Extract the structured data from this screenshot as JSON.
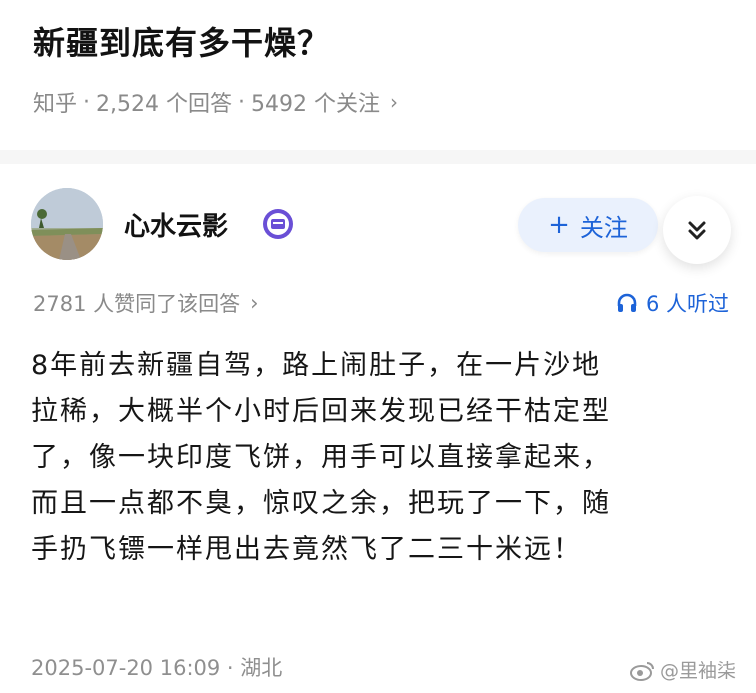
{
  "question": {
    "title": "新疆到底有多干燥？",
    "source": "知乎",
    "separator": "·",
    "answers": "2,524 个回答",
    "followers": "5492 个关注",
    "chevron": "›"
  },
  "author": {
    "name": "心水云影",
    "badge_icon": "verified-badge-icon",
    "follow_label": "关注",
    "follow_plus": "+",
    "expand_icon": "double-chevron-down-icon"
  },
  "answer": {
    "agree_text": "2781 人赞同了该回答",
    "agree_chevron": "›",
    "listen_text": "6 人听过",
    "content": "8年前去新疆自驾，路上闹肚子，在一片沙地\n拉稀，大概半个小时后回来发现已经干枯定型\n了，像一块印度飞饼，用手可以直接拿起来，\n而且一点都不臭，惊叹之余，把玩了一下，随\n手扔飞镖一样甩出去竟然飞了二三十米远！",
    "timestamp": "2025-07-20 16:09 · 湖北"
  },
  "watermark": {
    "text": "@里袖柒"
  },
  "colors": {
    "accent": "#1d63d8",
    "badge": "#6a4fd6",
    "meta_gray": "#8a8a8a"
  }
}
